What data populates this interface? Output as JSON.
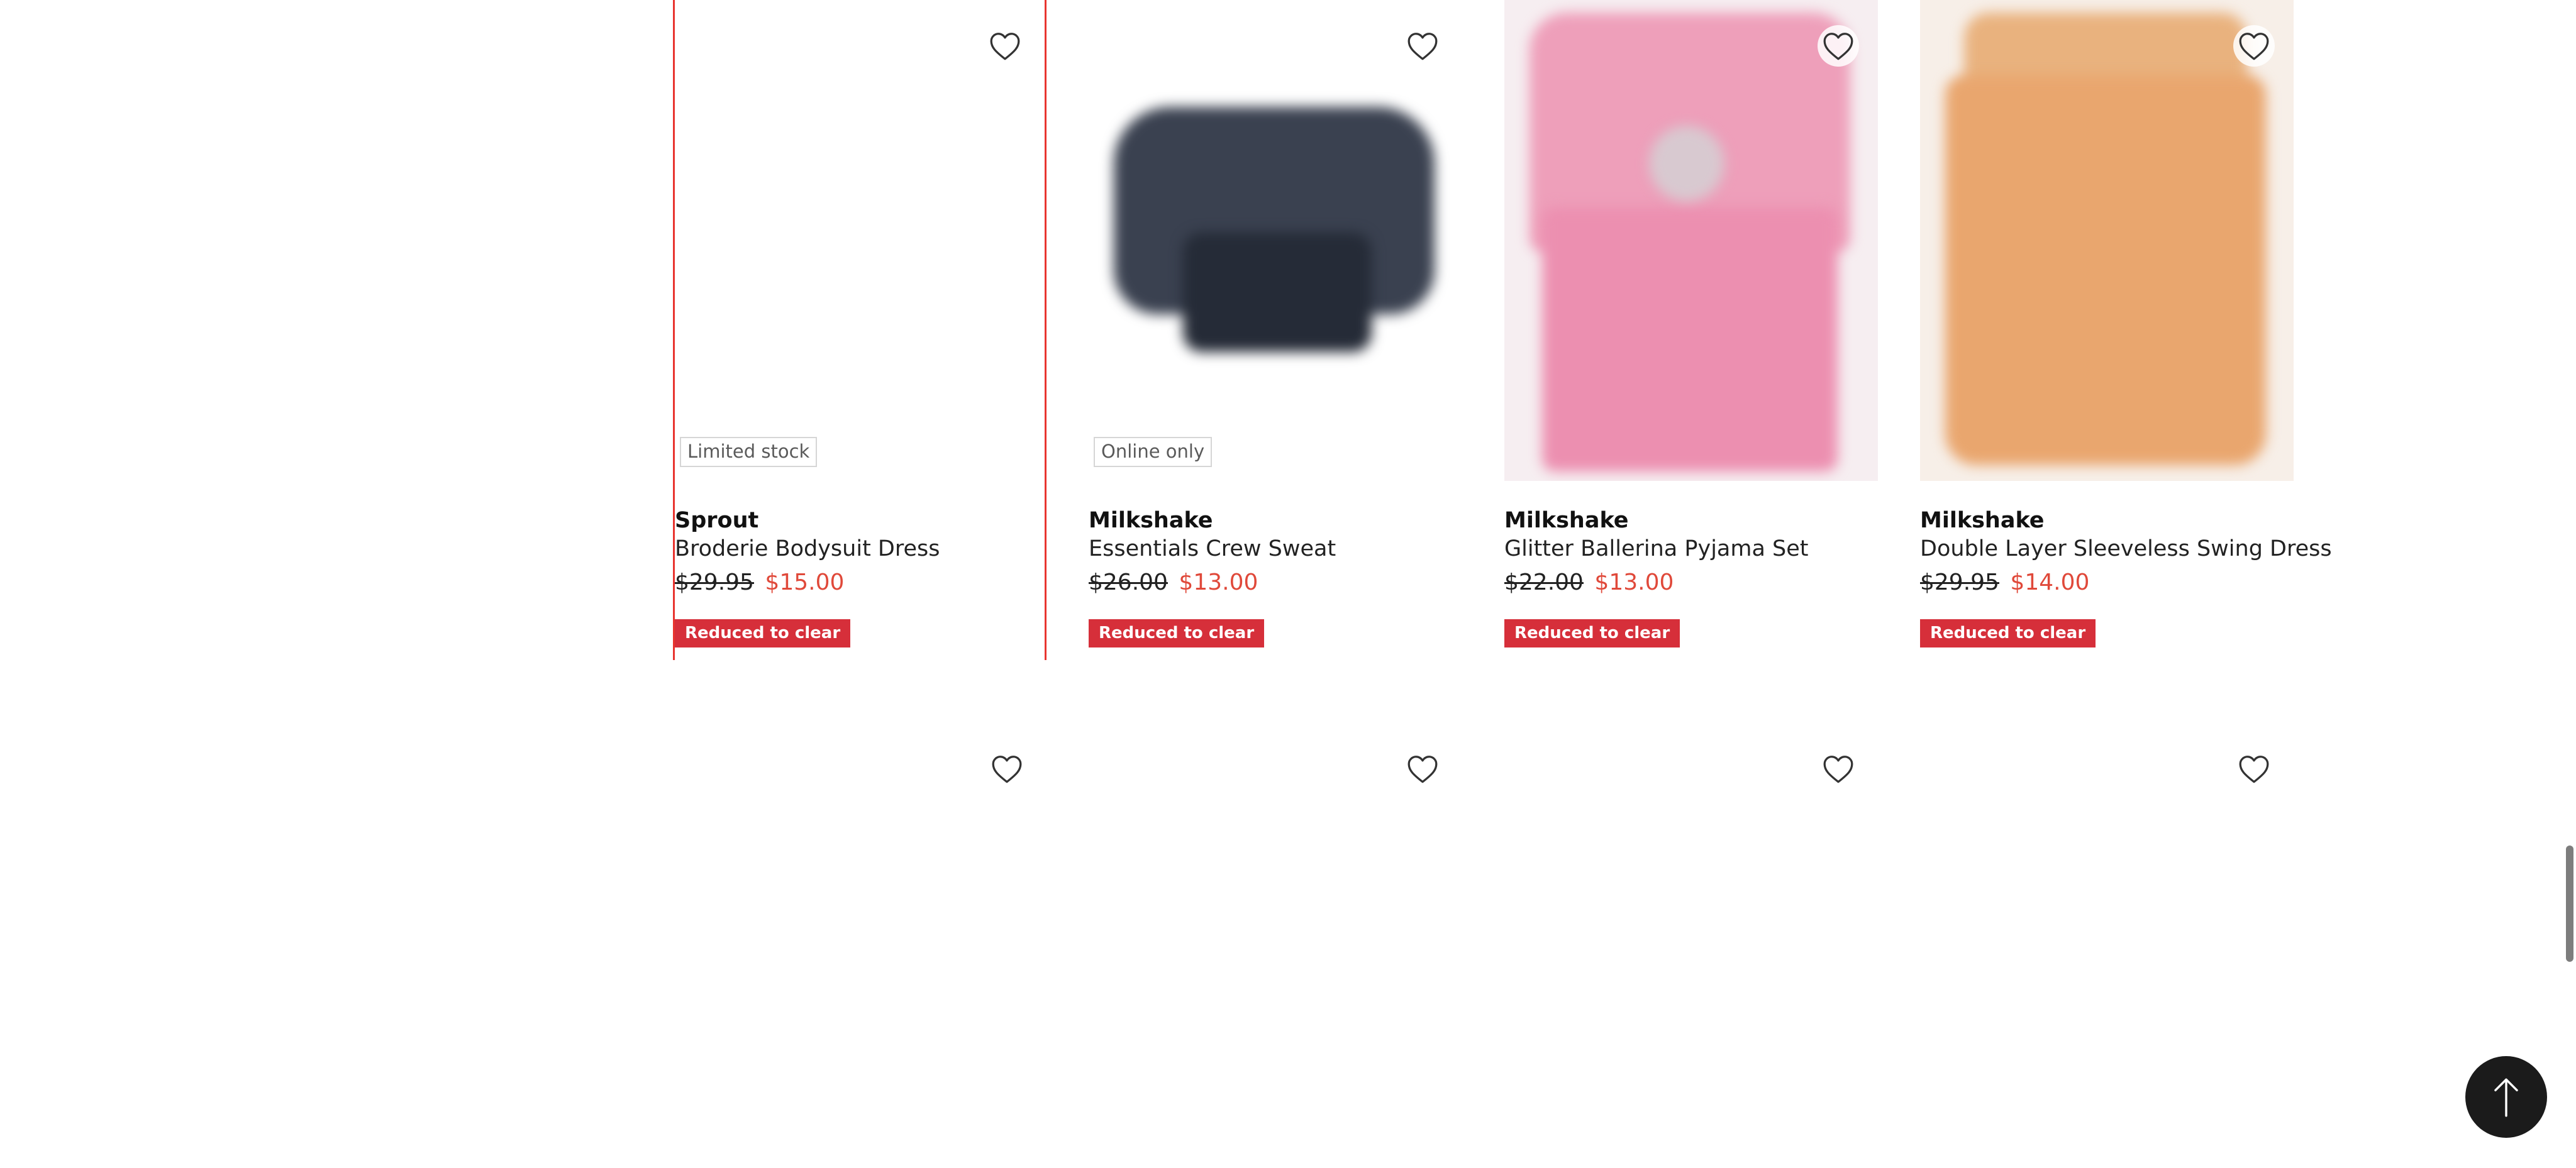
{
  "products_row1": [
    {
      "tag": "Limited stock",
      "brand": "Sprout",
      "title": "Broderie Bodysuit Dress",
      "was_price": "$29.95",
      "now_price": "$15.00",
      "badge": "Reduced to clear"
    },
    {
      "tag": "Online only",
      "brand": "Milkshake",
      "title": "Essentials Crew Sweat",
      "was_price": "$26.00",
      "now_price": "$13.00",
      "badge": "Reduced to clear"
    },
    {
      "brand": "Milkshake",
      "title": "Glitter Ballerina Pyjama Set",
      "was_price": "$22.00",
      "now_price": "$13.00",
      "badge": "Reduced to clear"
    },
    {
      "brand": "Milkshake",
      "title": "Double Layer Sleeveless Swing Dress",
      "was_price": "$29.95",
      "now_price": "$14.00",
      "badge": "Reduced to clear"
    }
  ],
  "icons": {
    "wishlist": "heart-outline-icon",
    "back_to_top": "arrow-up-icon"
  },
  "colors": {
    "sale_price": "#e0493a",
    "badge_bg": "#d62f3a",
    "focus_outline": "#e8342f",
    "back_to_top_bg": "#1b1b1b"
  }
}
